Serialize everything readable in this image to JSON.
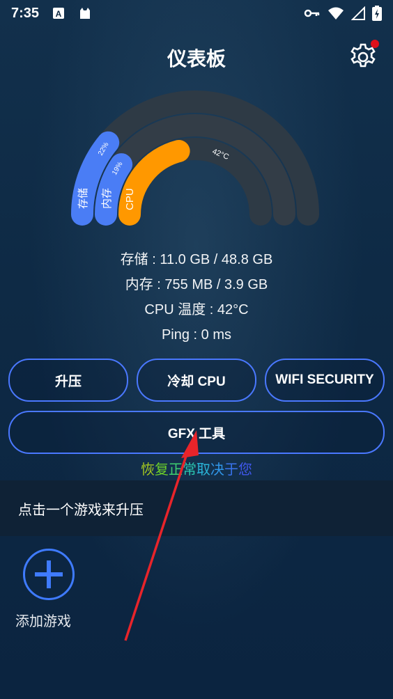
{
  "status_bar": {
    "time": "7:35",
    "icons": [
      "a-notification-icon",
      "cat-notification-icon",
      "vpn-key-icon",
      "wifi-icon",
      "signal-icon",
      "battery-icon"
    ]
  },
  "header": {
    "title": "仪表板",
    "settings_icon": "gear-icon",
    "notification_color": "#e0101a"
  },
  "gauge": {
    "storage": {
      "label": "存储",
      "percent": "22%",
      "fraction": 0.22,
      "color": "#4a7df5"
    },
    "memory": {
      "label": "内存",
      "percent": "19%",
      "fraction": 0.19,
      "color": "#4a7df5"
    },
    "cpu": {
      "label": "CPU",
      "temp": "42°C",
      "fraction": 0.42,
      "color": "#ff9800"
    },
    "track_color": "#2e3a45"
  },
  "stats": {
    "storage": "存储 : 11.0 GB / 48.8 GB",
    "memory": "内存 : 755 MB / 3.9 GB",
    "cpu_temp": "CPU 温度 : 42°C",
    "ping": "Ping : 0 ms"
  },
  "buttons": {
    "boost": "升压",
    "cool_cpu": "冷却 CPU",
    "wifi_security": "WIFI SECURITY",
    "gfx_tool": "GFX 工具"
  },
  "rainbow_text": [
    "恢",
    "复",
    "正",
    "常",
    "取",
    "决",
    "于",
    "您"
  ],
  "games": {
    "header": "点击一个游戏来升压",
    "add_label": "添加游戏"
  },
  "colors": {
    "accent_blue": "#4a78ff",
    "cpu_orange": "#ff9800",
    "annotation_red": "#e8242a"
  }
}
